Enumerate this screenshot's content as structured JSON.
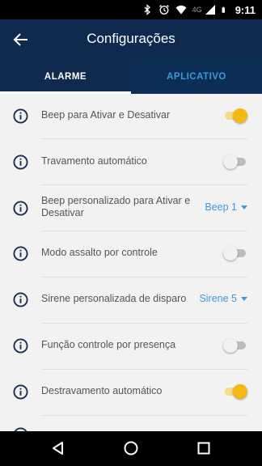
{
  "status_bar": {
    "network_label": "4G",
    "time": "9:11",
    "icons": [
      "bluetooth-icon",
      "alarm-clock-icon",
      "wifi-icon",
      "cell-signal-icon",
      "battery-icon"
    ]
  },
  "header": {
    "title": "Configurações",
    "back_icon": "arrow-left-icon"
  },
  "tabs": [
    {
      "label": "ALARME",
      "selected": true
    },
    {
      "label": "APLICATIVO",
      "selected": false
    }
  ],
  "settings": [
    {
      "label": "Beep para Ativar e Desativar",
      "control": "toggle",
      "on": true
    },
    {
      "label": "Travamento automático",
      "control": "toggle",
      "on": false
    },
    {
      "label": "Beep personalizado para Ativar e Desativar",
      "control": "dropdown",
      "value": "Beep 1"
    },
    {
      "label": "Modo assalto por controle",
      "control": "toggle",
      "on": false
    },
    {
      "label": "Sirene personalizada de disparo",
      "control": "dropdown",
      "value": "Sirene 5"
    },
    {
      "label": "Função controle por presença",
      "control": "toggle",
      "on": false
    },
    {
      "label": "Destravamento automático",
      "control": "toggle",
      "on": true
    }
  ],
  "colors": {
    "header_bg": "#0e2a4e",
    "tab_inactive_text": "#3a9ad9",
    "toggle_on": "#f5b914",
    "dropdown_text": "#3a9ad9"
  },
  "nav_bar": [
    "back-triangle-icon",
    "home-circle-icon",
    "recents-square-icon"
  ]
}
